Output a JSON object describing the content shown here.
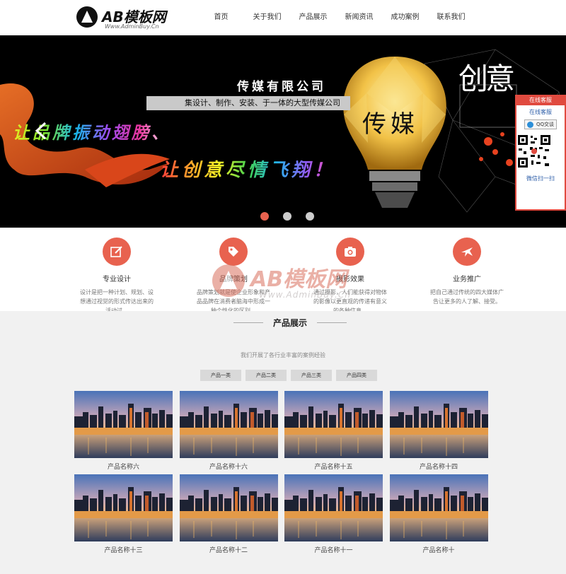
{
  "logo": {
    "text": "AB模板网",
    "sub": "Www.AdminBuy.Cn"
  },
  "nav": [
    "首页",
    "关于我们",
    "产品展示",
    "新闻资讯",
    "成功案例",
    "联系我们"
  ],
  "banner": {
    "title": "传媒有限公司",
    "subtitle": "集设计、制作、安装、于一体的大型传媒公司",
    "slogan1": "让品牌振动翅膀、",
    "slogan2": "让创意尽情飞翔！",
    "bulb_word": "传媒",
    "side_word": "创意",
    "active_slide": 1,
    "slide_count": 3
  },
  "float_panel": {
    "title": "在线客服",
    "online": "在线客服",
    "qq": "QQ交谈",
    "scan": "微信扫一扫"
  },
  "services": [
    {
      "title": "专业设计",
      "desc": "设计是把一种计划、规划、设想通过视觉的形式传达出来的活动过。",
      "icon": "edit-icon"
    },
    {
      "title": "品牌策划",
      "desc": "品牌策划就是使企业形象和产品品牌在消费者脑海中形成一种个性化的区别。",
      "icon": "tag-icon"
    },
    {
      "title": "摄影效果",
      "desc": "通过摄影，人们能获得对物体的影像以更直观的传递有意义的各种信息。",
      "icon": "camera-icon"
    },
    {
      "title": "业务推广",
      "desc": "把自己通过传统的四大媒体广告让更多的人了解、接受。",
      "icon": "plane-icon"
    }
  ],
  "watermark": {
    "text": "AB模板网",
    "sub": "Www.AdminBuy.Cn"
  },
  "products": {
    "title": "产品展示",
    "subtitle": "我们开展了各行业丰富的案例经验",
    "tabs": [
      "产品一类",
      "产品二类",
      "产品三类",
      "产品四类"
    ],
    "items": [
      "产品名称六",
      "产品名称十六",
      "产品名称十五",
      "产品名称十四",
      "产品名称十三",
      "产品名称十二",
      "产品名称十一",
      "产品名称十"
    ]
  },
  "colors": {
    "accent": "#e8624f",
    "panel_red": "#e04a3f",
    "products_bg": "#f1f1f1"
  }
}
